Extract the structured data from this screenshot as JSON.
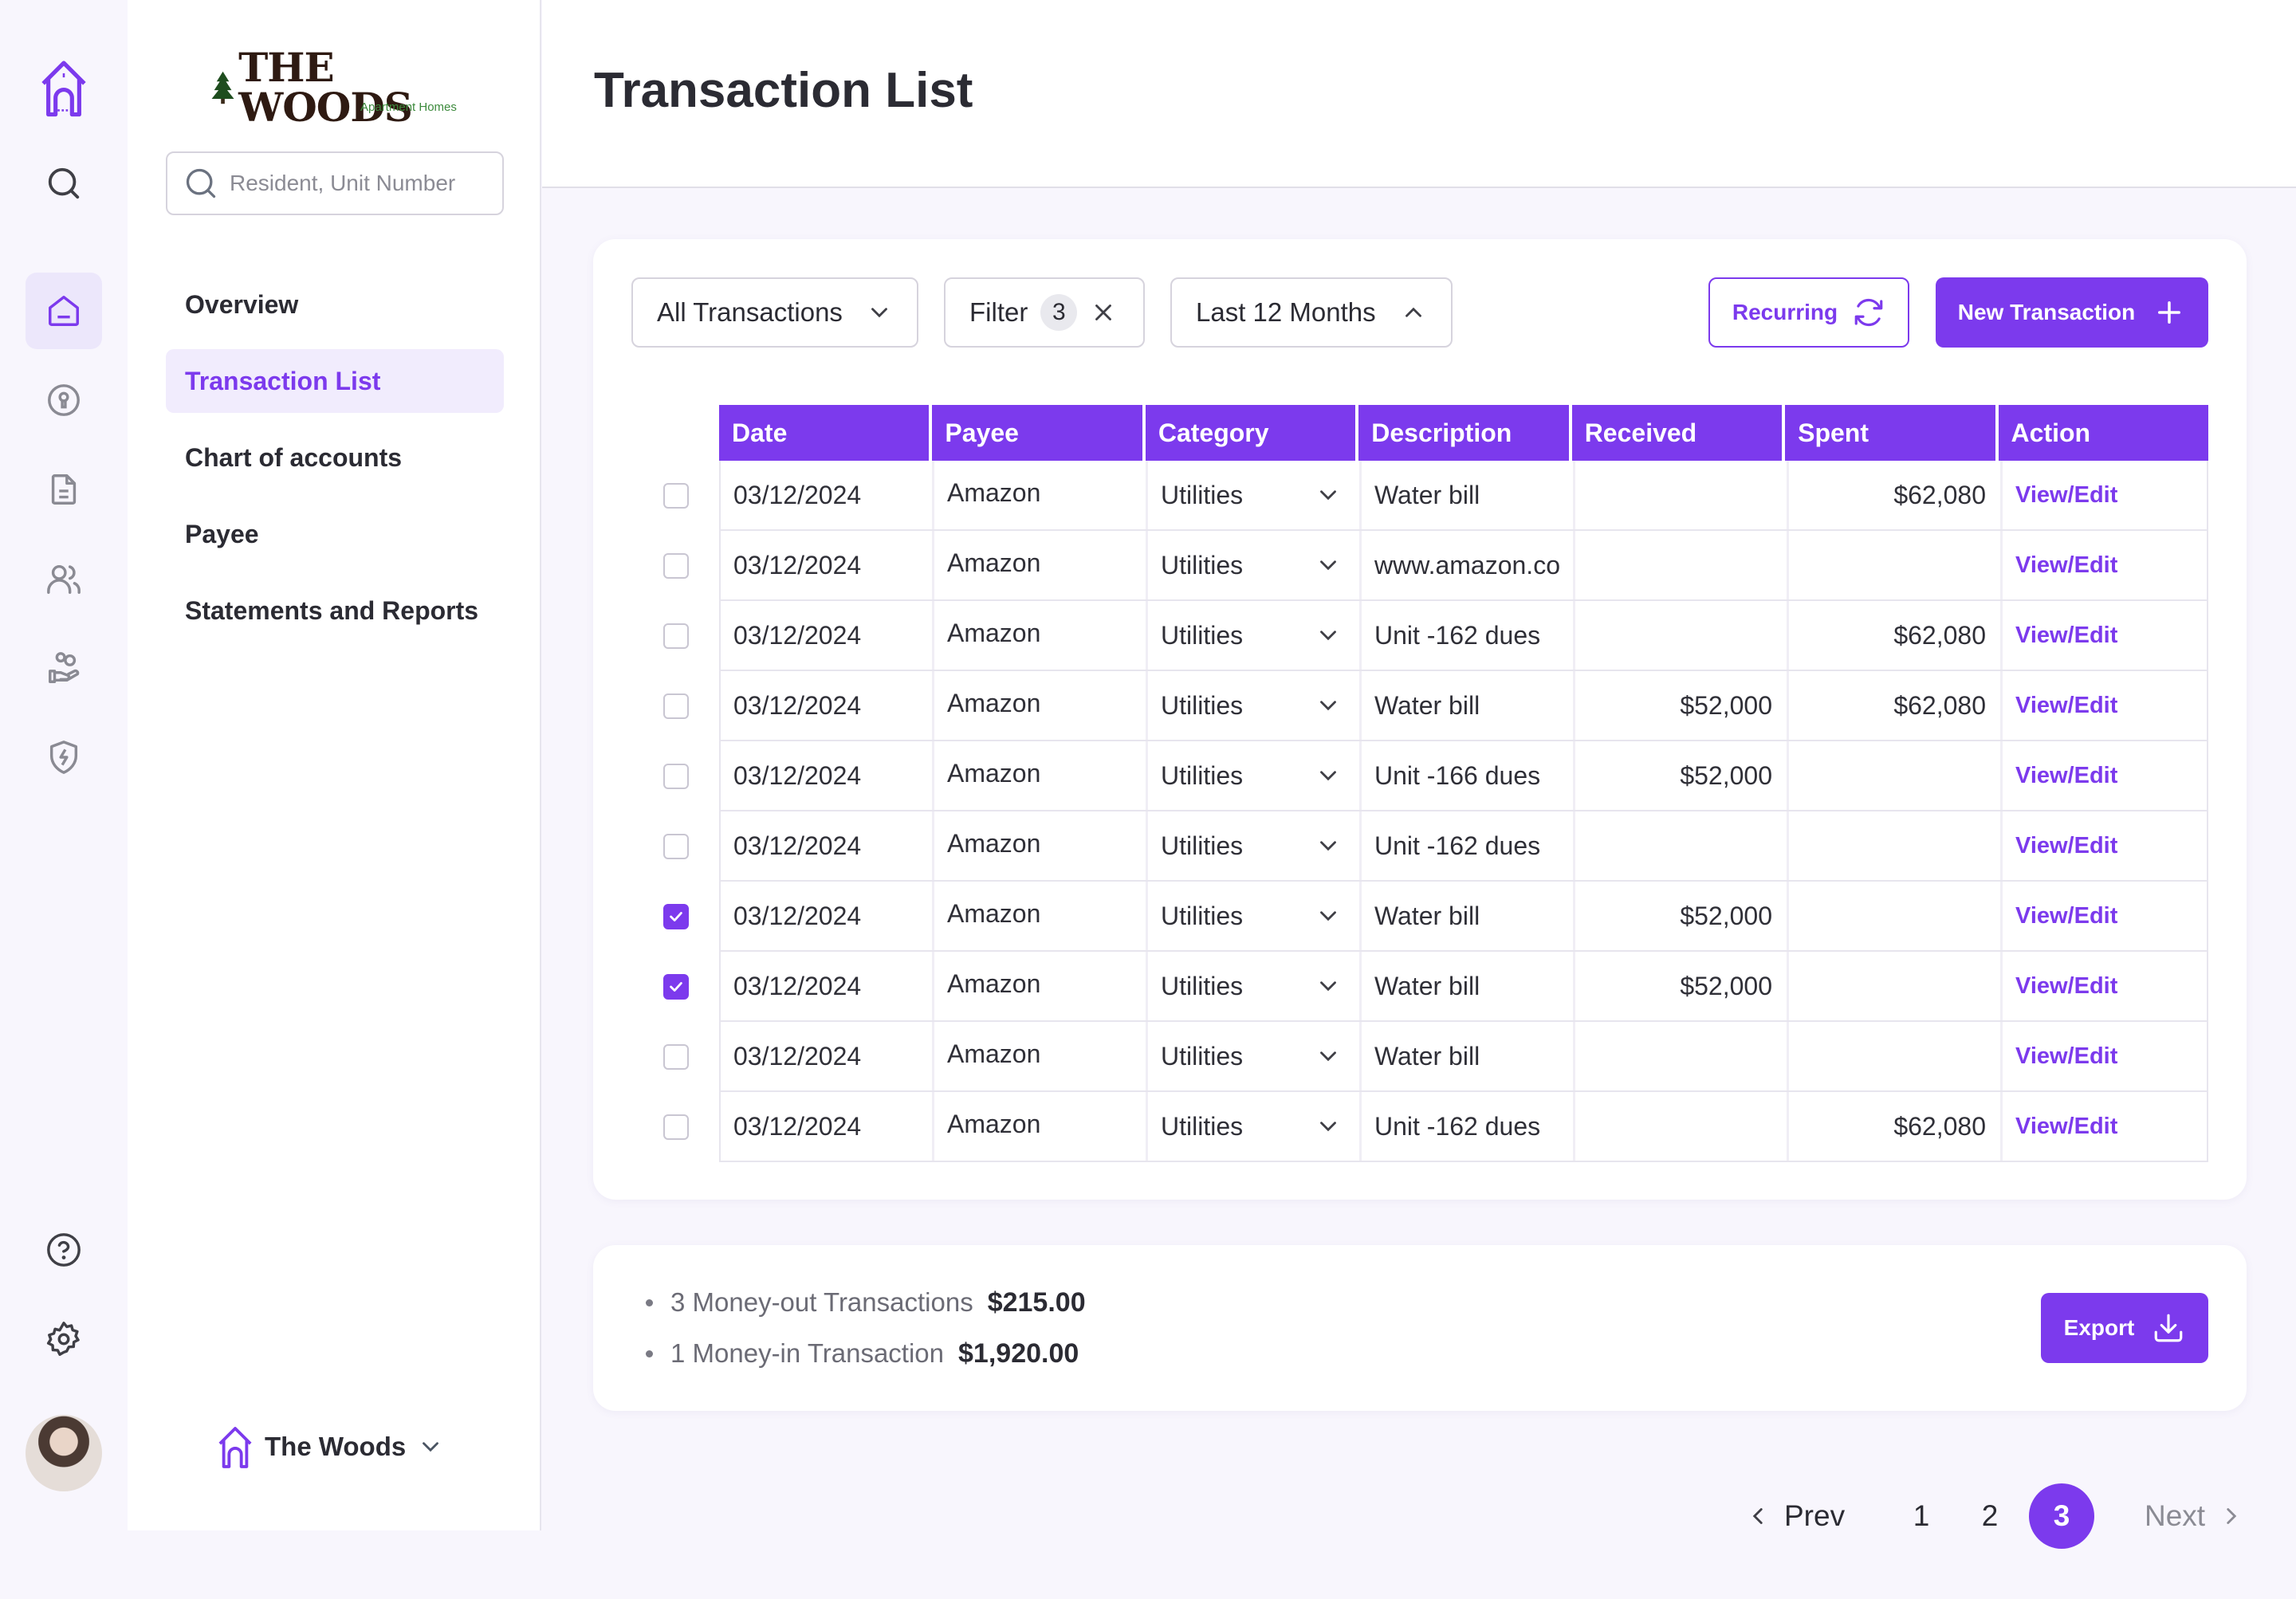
{
  "app": {
    "brand": "THE WOODS",
    "brand_sub": "Apartment Homes",
    "accent": "#7c3aed"
  },
  "rail": {
    "icons": [
      "home-logo-icon",
      "search-icon",
      "home-icon",
      "keyhole-icon",
      "document-icon",
      "users-icon",
      "hand-coins-icon",
      "shield-bolt-icon",
      "help-icon",
      "settings-icon"
    ]
  },
  "sidebar": {
    "search_placeholder": "Resident, Unit Number",
    "items": [
      {
        "label": "Overview"
      },
      {
        "label": "Transaction List"
      },
      {
        "label": "Chart of accounts"
      },
      {
        "label": "Payee"
      },
      {
        "label": "Statements and Reports"
      }
    ],
    "property": "The Woods"
  },
  "header": {
    "title": "Transaction List"
  },
  "toolbar": {
    "type_select": "All Transactions",
    "filter_label": "Filter",
    "filter_count": "3",
    "range_select": "Last 12 Months",
    "recurring_label": "Recurring",
    "new_label": "New Transaction"
  },
  "table": {
    "columns": [
      "Date",
      "Payee",
      "Category",
      "Description",
      "Received",
      "Spent",
      "Action"
    ],
    "rows": [
      {
        "checked": false,
        "date": "03/12/2024",
        "payee": "Amazon",
        "category": "Utilities",
        "description": "Water bill",
        "received": "",
        "spent": "$62,080",
        "action": "View/Edit"
      },
      {
        "checked": false,
        "date": "03/12/2024",
        "payee": "Amazon",
        "category": "Utilities",
        "description": "www.amazon.co",
        "received": "",
        "spent": "",
        "action": "View/Edit"
      },
      {
        "checked": false,
        "date": "03/12/2024",
        "payee": "Amazon",
        "category": "Utilities",
        "description": "Unit -162 dues",
        "received": "",
        "spent": "$62,080",
        "action": "View/Edit"
      },
      {
        "checked": false,
        "date": "03/12/2024",
        "payee": "Amazon",
        "category": "Utilities",
        "description": "Water bill",
        "received": "$52,000",
        "spent": "$62,080",
        "action": "View/Edit"
      },
      {
        "checked": false,
        "date": "03/12/2024",
        "payee": "Amazon",
        "category": "Utilities",
        "description": "Unit -166 dues",
        "received": "$52,000",
        "spent": "",
        "action": "View/Edit"
      },
      {
        "checked": false,
        "date": "03/12/2024",
        "payee": "Amazon",
        "category": "Utilities",
        "description": "Unit -162 dues",
        "received": "",
        "spent": "",
        "action": "View/Edit"
      },
      {
        "checked": true,
        "date": "03/12/2024",
        "payee": "Amazon",
        "category": "Utilities",
        "description": "Water bill",
        "received": "$52,000",
        "spent": "",
        "action": "View/Edit"
      },
      {
        "checked": true,
        "date": "03/12/2024",
        "payee": "Amazon",
        "category": "Utilities",
        "description": "Water bill",
        "received": "$52,000",
        "spent": "",
        "action": "View/Edit"
      },
      {
        "checked": false,
        "date": "03/12/2024",
        "payee": "Amazon",
        "category": "Utilities",
        "description": "Water bill",
        "received": "",
        "spent": "",
        "action": "View/Edit"
      },
      {
        "checked": false,
        "date": "03/12/2024",
        "payee": "Amazon",
        "category": "Utilities",
        "description": "Unit -162 dues",
        "received": "",
        "spent": "$62,080",
        "action": "View/Edit"
      }
    ]
  },
  "summary": {
    "out_label": "3 Money-out Transactions",
    "out_value": "$215.00",
    "in_label": "1 Money-in Transaction",
    "in_value": "$1,920.00",
    "export_label": "Export"
  },
  "pagination": {
    "prev": "Prev",
    "pages": [
      "1",
      "2",
      "3"
    ],
    "current": "3",
    "next": "Next"
  }
}
